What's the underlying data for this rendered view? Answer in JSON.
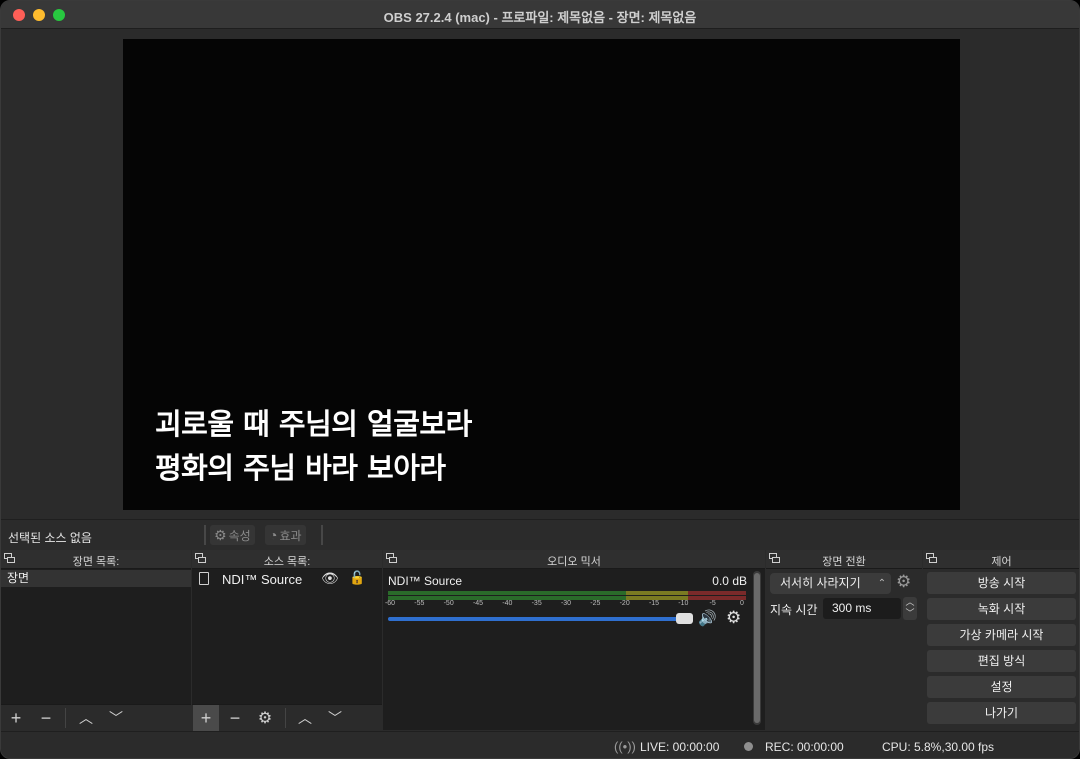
{
  "window": {
    "title": "OBS 27.2.4 (mac) - 프로파일: 제목없음 - 장면: 제목없음"
  },
  "preview": {
    "lyric_line1": "괴로울 때 주님의 얼굴보라",
    "lyric_line2": "평화의 주님 바라 보아라"
  },
  "context_bar": {
    "no_source_label": "선택된 소스 없음",
    "properties_label": "속성",
    "filters_label": "효과"
  },
  "scenes": {
    "title": "장면 목록:",
    "items": [
      "장면"
    ]
  },
  "sources": {
    "title": "소스 목록:",
    "items": [
      {
        "label": "NDI™ Source",
        "visible": true,
        "locked": false
      }
    ]
  },
  "audio_mixer": {
    "title": "오디오 믹서",
    "channels": [
      {
        "name": "NDI™ Source",
        "level": "0.0 dB",
        "volume": 1.0
      }
    ],
    "scale": [
      "-60",
      "-55",
      "-50",
      "-45",
      "-40",
      "-35",
      "-30",
      "-25",
      "-20",
      "-15",
      "-10",
      "-5",
      "0"
    ]
  },
  "transitions": {
    "title": "장면 전환",
    "selected": "서서히 사라지기",
    "duration_label": "지속 시간",
    "duration_value": "300 ms"
  },
  "controls": {
    "title": "제어",
    "buttons": [
      "방송 시작",
      "녹화 시작",
      "가상 카메라 시작",
      "편집 방식",
      "설정",
      "나가기"
    ]
  },
  "status_bar": {
    "live": "LIVE: 00:00:00",
    "rec": "REC: 00:00:00",
    "cpu": "CPU: 5.8%,30.00 fps"
  },
  "colors": {
    "meter_green": "#2a6b2a",
    "meter_yellow": "#7a7a22",
    "meter_red": "#7a2a2a",
    "volume_slider": "#2f6fcf"
  },
  "icons": [
    "gear-icon",
    "filter-icon",
    "eye-icon",
    "lock-icon",
    "speaker-icon",
    "plus-icon",
    "minus-icon",
    "chevron-up-icon",
    "chevron-down-icon",
    "file-icon",
    "float-dock-icon",
    "broadcast-icon",
    "record-dot-icon"
  ]
}
